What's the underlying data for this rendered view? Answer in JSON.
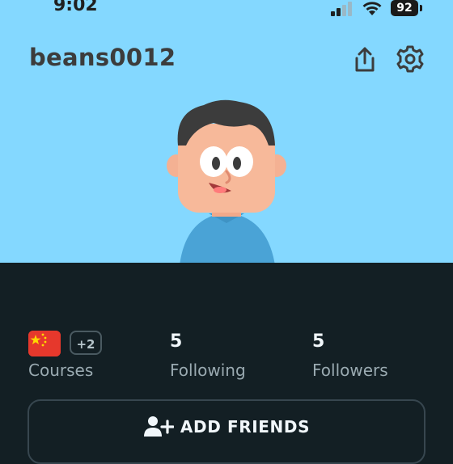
{
  "status_bar": {
    "time": "9:02",
    "battery": "92"
  },
  "profile": {
    "username": "beans0012"
  },
  "stats": {
    "courses": {
      "extra_badge": "+2",
      "label": "Courses"
    },
    "following": {
      "value": "5",
      "label": "Following"
    },
    "followers": {
      "value": "5",
      "label": "Followers"
    }
  },
  "actions": {
    "add_friends_label": "ADD FRIENDS"
  },
  "colors": {
    "header_bg": "#84d8ff",
    "panel_bg": "#131f24",
    "flag_red": "#e6382c"
  }
}
